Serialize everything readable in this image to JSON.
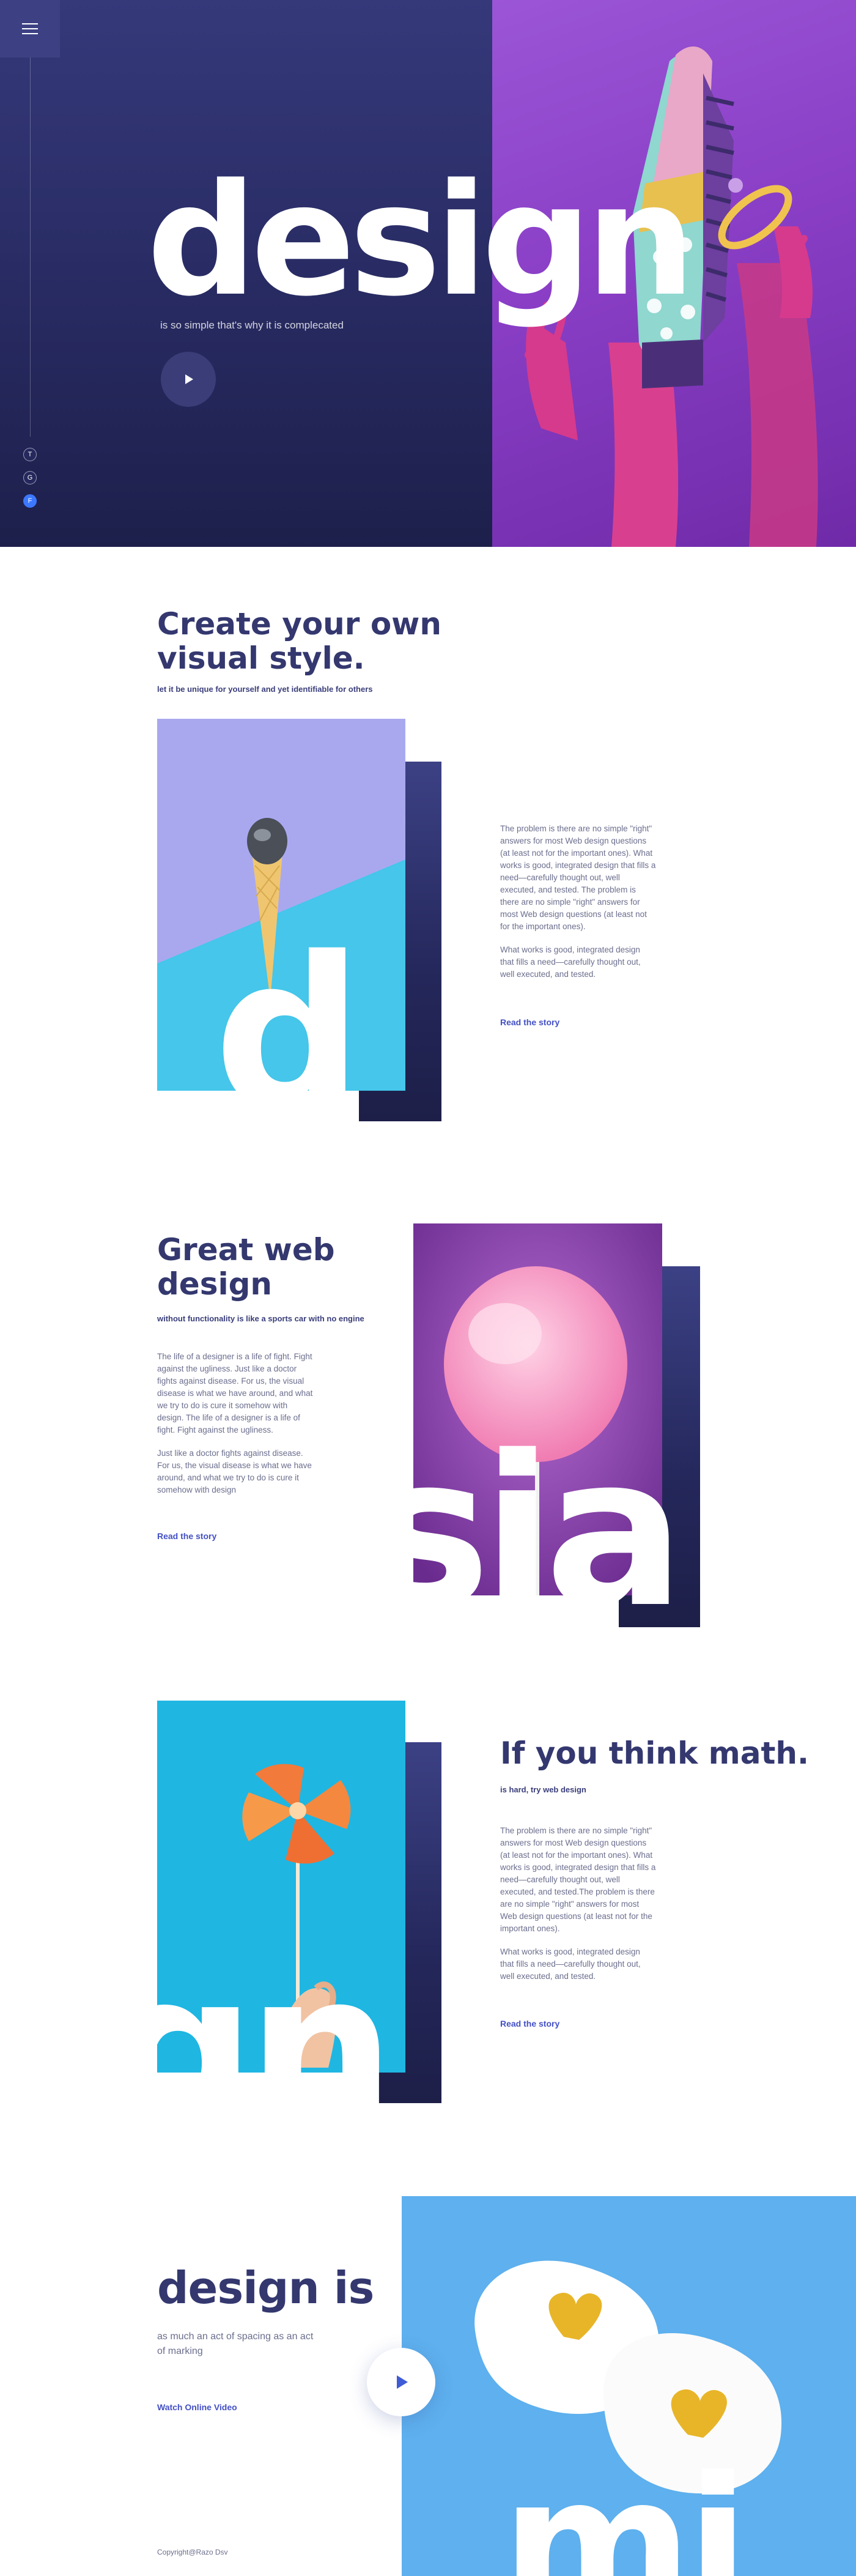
{
  "hero": {
    "menu_icon": "hamburger-icon",
    "title": "design",
    "subtitle": "is so simple that's why it is complecated",
    "play_icon": "play-icon",
    "social": [
      "T",
      "G",
      "F"
    ]
  },
  "section1": {
    "title_line1": "Create your own",
    "title_line2": "visual style.",
    "subtitle": "let it be unique for yourself and yet identifiable for others",
    "para1": "The problem is there are no simple \"right\" answers for most Web design questions (at least not for the important ones). What works is good, integrated design that fills a need—carefully thought out, well executed, and tested. The problem is there are no simple \"right\" answers for most Web design questions (at least not for the important ones).",
    "para2": "What works is good, integrated design that fills a need—carefully thought out, well executed, and tested.",
    "link": "Read the story",
    "big_letter": "d"
  },
  "section2": {
    "title_line1": "Great web",
    "title_line2": "design",
    "subtitle": "without functionality is like a sports car with no engine",
    "para1": "The life of a designer is a life of fight. Fight against the ugliness. Just like a doctor fights against disease. For us, the visual disease is what we have around, and what we try to do is cure it somehow with design. The life of a designer is a life of fight. Fight against the ugliness.",
    "para2": "Just like a doctor fights against disease. For us, the visual disease is what we have around, and what we try to do is cure it somehow with design",
    "link": "Read the story",
    "big_letters": "sia"
  },
  "section3": {
    "title": "If you think math.",
    "subtitle": "is hard, try web design",
    "para1": "The problem is there are no simple \"right\" answers for most Web design questions (at least not for the important ones). What works is good, integrated design that fills a need—carefully thought out, well executed, and tested.The problem is there are no simple \"right\" answers for most Web design questions (at least not for the important ones).",
    "para2": "What works is good, integrated design that fills a need—carefully thought out, well executed, and tested.",
    "link": "Read the story",
    "big_letters": "gn"
  },
  "section4": {
    "title": "design is",
    "subtitle": "as much an act of spacing as an act of marking",
    "link": "Watch Online Video",
    "play_icon": "play-icon",
    "big_letters": "mi"
  },
  "footer": {
    "copyright": "Copyright@Razo Dsv"
  },
  "colors": {
    "navy": "#2b2f63",
    "accent_blue": "#4350c4",
    "hero_purple": "#8a3fc6",
    "social_active": "#3c78ff"
  }
}
